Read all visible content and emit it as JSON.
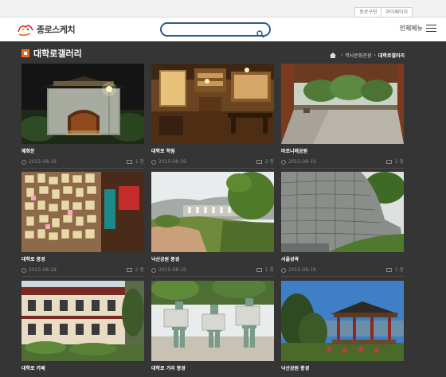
{
  "top_links": [
    "종로구청",
    "마이페이지"
  ],
  "logo": {
    "text": "종로스케치"
  },
  "search": {
    "placeholder": "",
    "value": ""
  },
  "menu": {
    "label": "전체메뉴"
  },
  "page": {
    "title": "대학로갤러리"
  },
  "breadcrumb": {
    "items": [
      "역사문화관광",
      "대학로갤러리"
    ]
  },
  "colors": {
    "accent": "#e8701b",
    "background": "#353535",
    "search_border": "#2d5a8a"
  },
  "gallery": [
    {
      "caption": "혜화문",
      "date": "2015-08-19",
      "count": "1 장",
      "scene": "gate-night"
    },
    {
      "caption": "대학로 학림",
      "date": "2015-08-19",
      "count": "2 장",
      "scene": "cafe-interior"
    },
    {
      "caption": "마로니에공원",
      "date": "2015-08-19",
      "count": "1 장",
      "scene": "park-plaza"
    },
    {
      "caption": "대학로 풍경",
      "date": "2015-08-19",
      "count": "2 장",
      "scene": "notes-wall"
    },
    {
      "caption": "낙산공원 풍경",
      "date": "2015-08-19",
      "count": "1 장",
      "scene": "city-view"
    },
    {
      "caption": "서울성곽",
      "date": "2015-08-19",
      "count": "1 장",
      "scene": "fortress-wall"
    },
    {
      "caption": "대학로 카페",
      "date": "",
      "count": "",
      "scene": "building"
    },
    {
      "caption": "대학로 거리 풍경",
      "date": "",
      "count": "",
      "scene": "statues"
    },
    {
      "caption": "낙산공원 풍경",
      "date": "",
      "count": "",
      "scene": "pavilion"
    }
  ]
}
